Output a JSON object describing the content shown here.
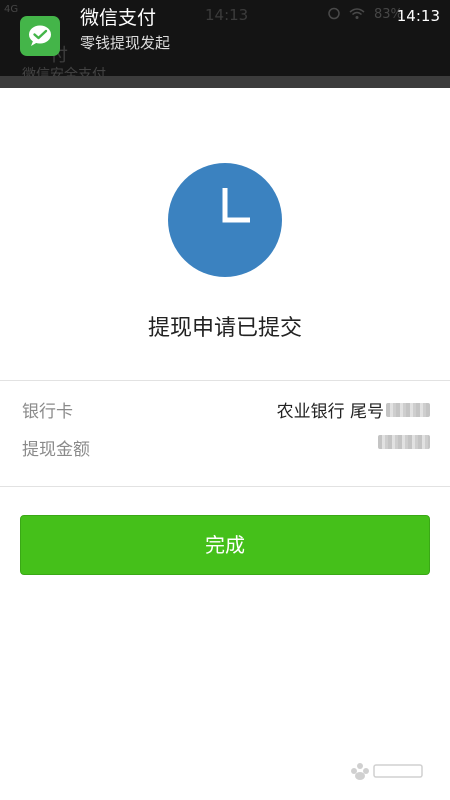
{
  "status_bar": {
    "network": "4G",
    "time_behind": "14:13",
    "battery": "83%"
  },
  "notification": {
    "app_name": "微信支付",
    "message": "零钱提现发起",
    "time": "14:13",
    "icon": "wechat-logo-icon"
  },
  "result": {
    "status_icon": "clock-icon",
    "title": "提现申请已提交"
  },
  "details": [
    {
      "label": "银行卡",
      "value": "农业银行 尾号"
    },
    {
      "label": "提现金额",
      "value": ""
    }
  ],
  "actions": {
    "done_label": "完成"
  },
  "colors": {
    "accent_green": "#45c01a",
    "clock_blue": "#3b82c0",
    "notification_bg": "#141414"
  }
}
